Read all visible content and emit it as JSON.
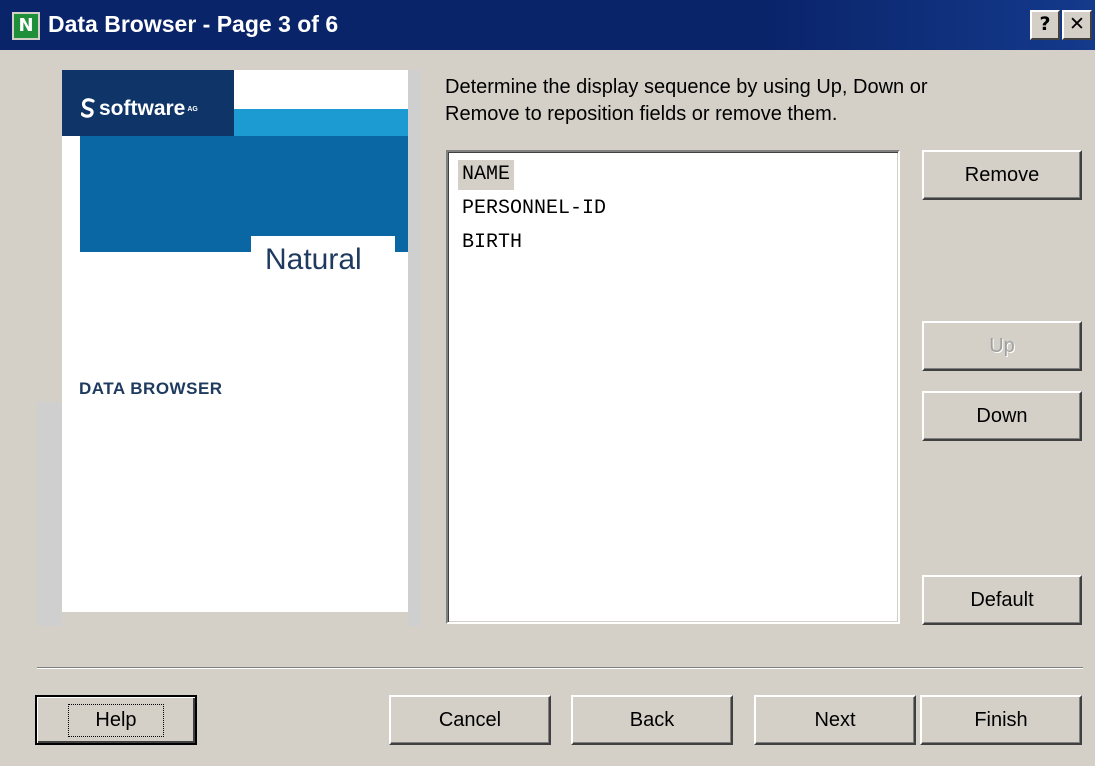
{
  "window": {
    "icon_letter": "N",
    "title": "Data Browser - Page 3 of 6",
    "help_button": "?",
    "close_button": "✕"
  },
  "banner": {
    "logo_text": "software",
    "logo_superscript": "AG",
    "product_name": "Natural",
    "caption": "DATA BROWSER",
    "colors": {
      "navy": "#0e3468",
      "blue": "#0a67a3",
      "cyan": "#1b9bd1"
    }
  },
  "instruction": {
    "line1": "Determine the display sequence by using Up, Down or",
    "line2": "Remove to reposition fields or remove them."
  },
  "fields": {
    "items": [
      "NAME",
      "PERSONNEL-ID",
      "BIRTH"
    ],
    "selected_index": 0
  },
  "side_buttons": {
    "remove": "Remove",
    "up": "Up",
    "down": "Down",
    "default": "Default"
  },
  "footer_buttons": {
    "help": "Help",
    "cancel": "Cancel",
    "back": "Back",
    "next": "Next",
    "finish": "Finish"
  }
}
